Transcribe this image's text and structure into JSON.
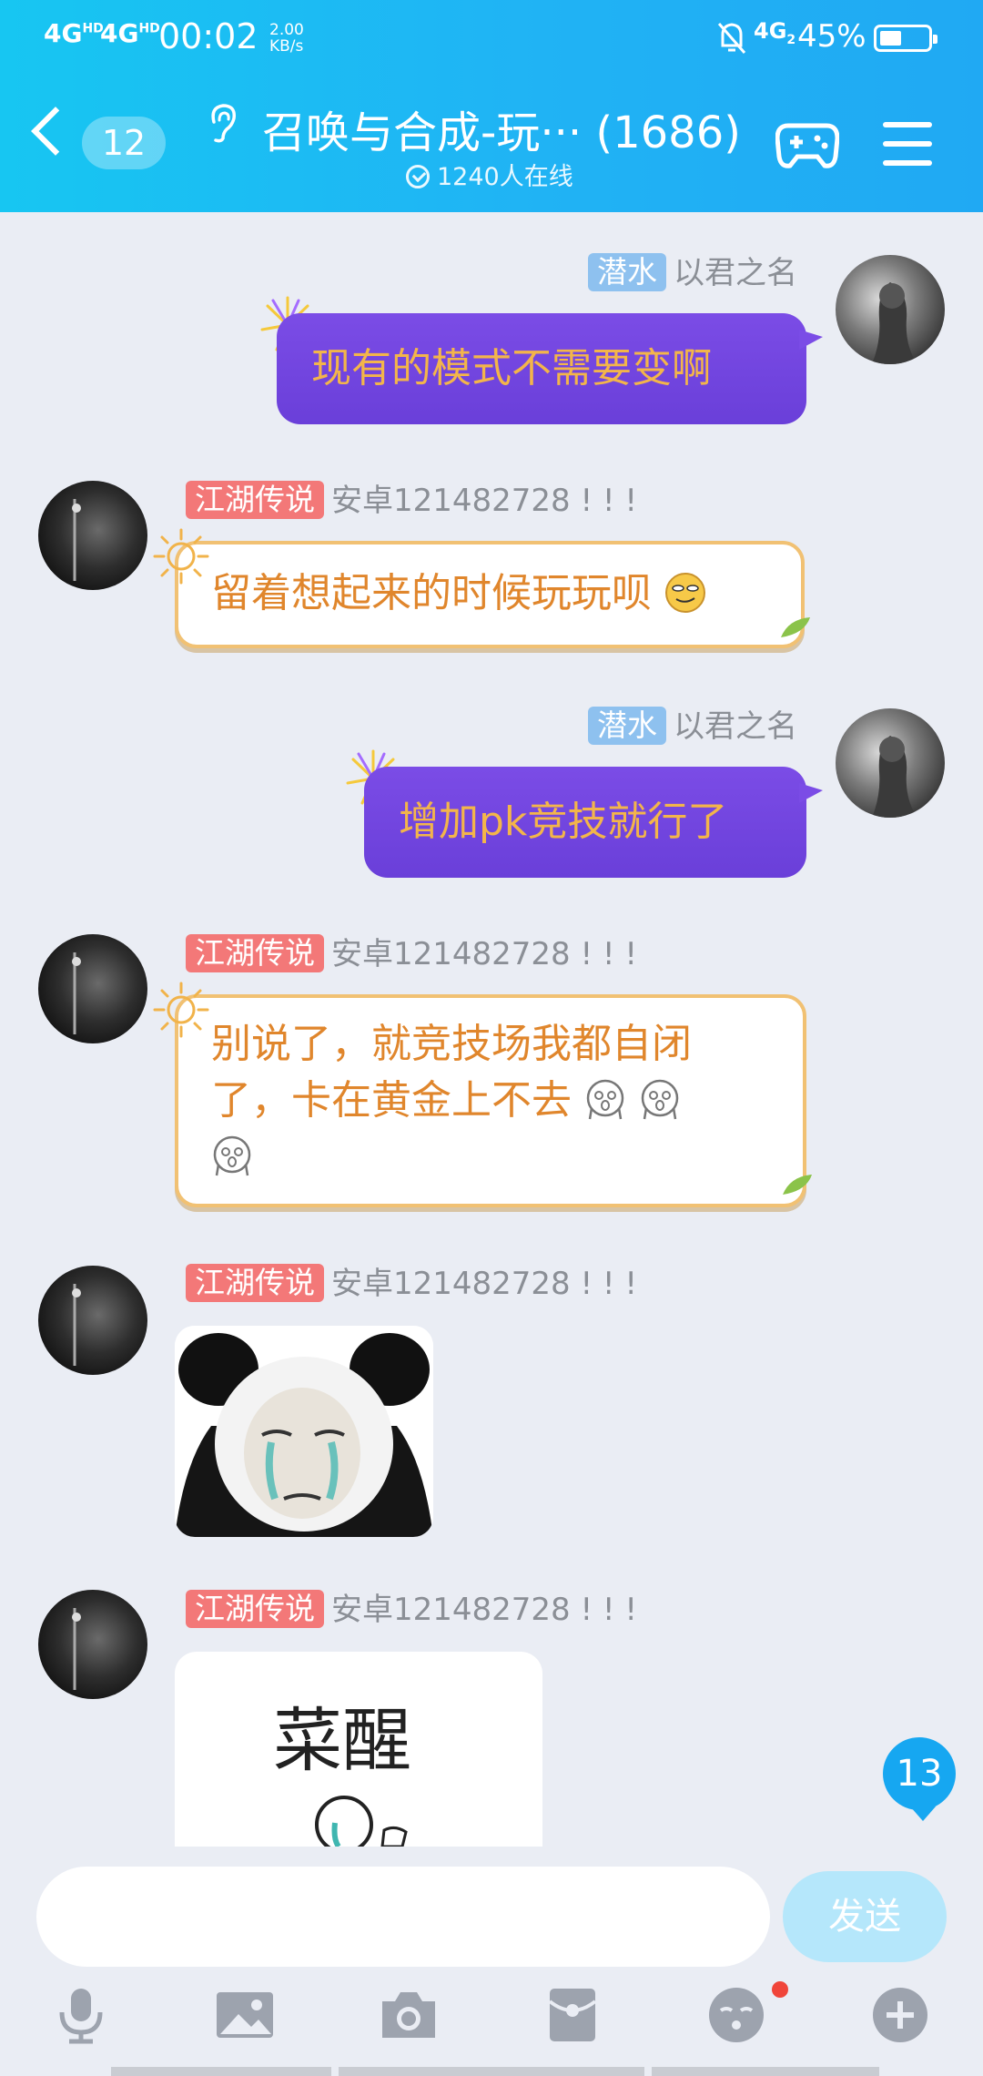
{
  "status_bar": {
    "network1": "4G",
    "network1_sup": "HD",
    "network2": "4G",
    "network2_sup": "HD",
    "time": "00:02",
    "speed_value": "2.00",
    "speed_unit": "KB/s",
    "network3": "4G",
    "network3_sub": "2",
    "battery": "45%",
    "battery_level": 0.45
  },
  "header": {
    "back_count": "12",
    "title": "召唤与合成-玩··· (1686)",
    "online": "1240人在线"
  },
  "messages": [
    {
      "side": "right",
      "badge": "潜水",
      "name": "以君之名",
      "text": "现有的模式不需要变啊"
    },
    {
      "side": "left",
      "badge": "江湖传说",
      "name": "安卓121482728 ! ! !",
      "text": "留着想起来的时候玩玩呗"
    },
    {
      "side": "right",
      "badge": "潜水",
      "name": "以君之名",
      "text": "增加pk竞技就行了"
    },
    {
      "side": "left",
      "badge": "江湖传说",
      "name": "安卓121482728 ! ! !",
      "text_line1": "别说了，就竞技场我都自闭",
      "text_line2": "了，卡在黄金上不去"
    },
    {
      "side": "left",
      "badge": "江湖传说",
      "name": "安卓121482728 ! ! !",
      "sticker": "panda-crying-sticker"
    },
    {
      "side": "left",
      "badge": "江湖传说",
      "name": "安卓121482728 ! ! !",
      "sticker_text": "菜醒"
    }
  ],
  "new_messages_count": "13",
  "composer": {
    "placeholder": "",
    "send_label": "发送"
  },
  "toolbar": [
    "microphone-icon",
    "image-icon",
    "camera-icon",
    "red-packet-icon",
    "emoji-icon",
    "plus-icon"
  ],
  "colors": {
    "header": "#20b3f4",
    "purple_bubble": "#6a3fd9",
    "bubble_text": "#f3b54a",
    "orange_text": "#e0862c"
  }
}
